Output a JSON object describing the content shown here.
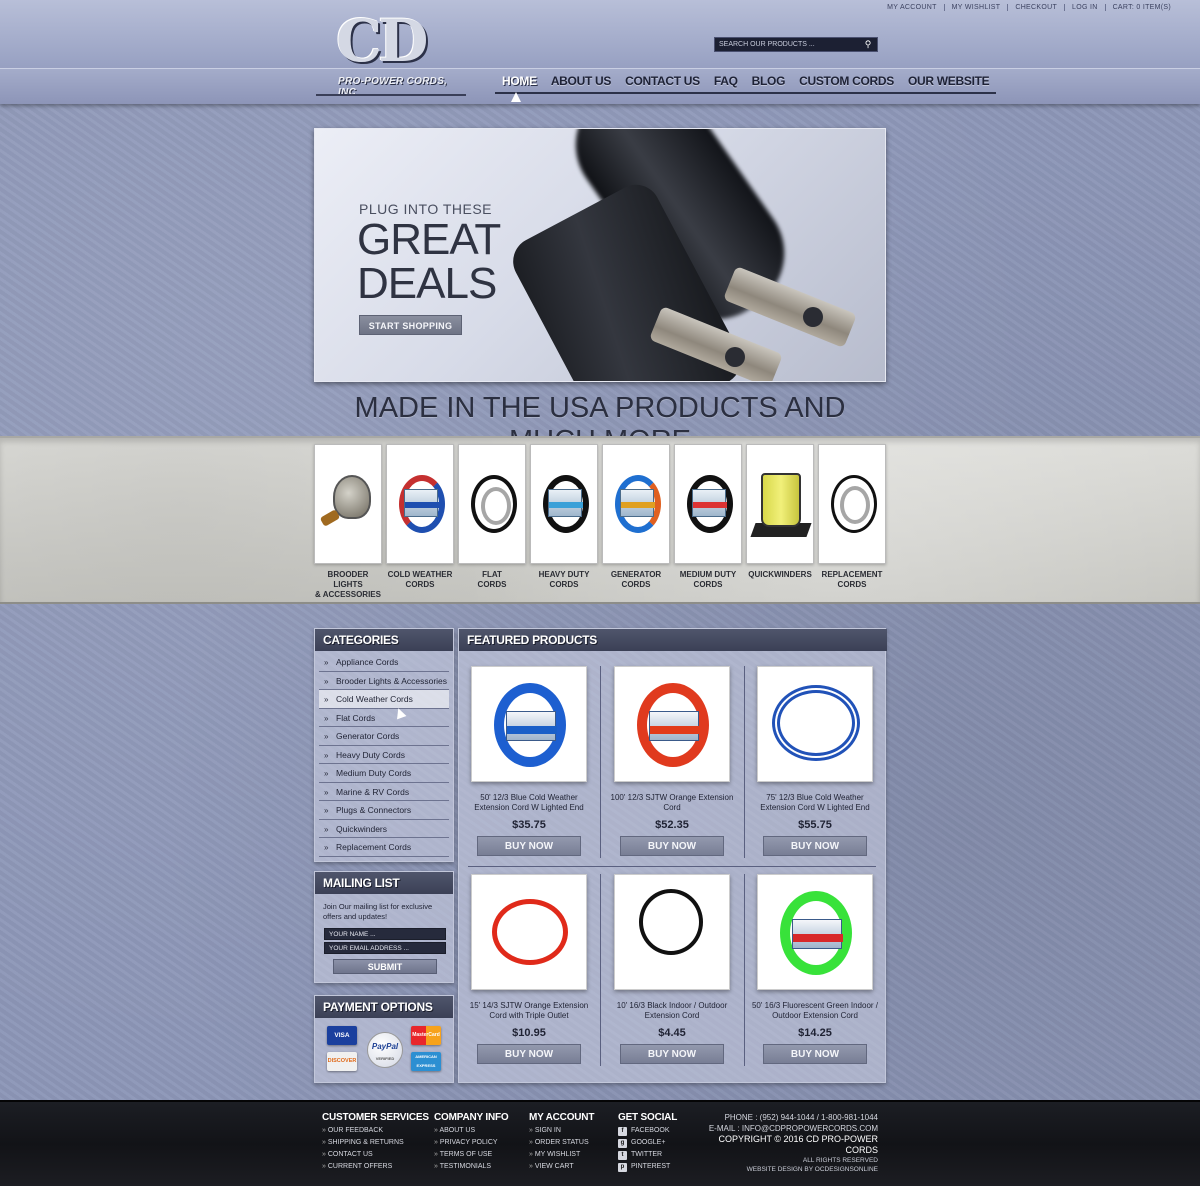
{
  "top_links": [
    "MY ACCOUNT",
    "MY WISHLIST",
    "CHECKOUT",
    "LOG IN",
    "CART: 0 ITEM(S)"
  ],
  "search": {
    "placeholder": "SEARCH OUR PRODUCTS ..."
  },
  "logo": {
    "letters": "CD",
    "tagline": "PRO-POWER CORDS, INC"
  },
  "nav": [
    {
      "label": "HOME",
      "active": true
    },
    {
      "label": "ABOUT US"
    },
    {
      "label": "CONTACT US"
    },
    {
      "label": "FAQ"
    },
    {
      "label": "BLOG"
    },
    {
      "label": "CUSTOM CORDS"
    },
    {
      "label": "OUR WEBSITE"
    }
  ],
  "hero": {
    "line1": "PLUG INTO THESE",
    "line2": "GREAT",
    "line3": "DEALS",
    "button": "START SHOPPING"
  },
  "tagline": "MADE IN THE USA PRODUCTS AND MUCH MORE",
  "category_tiles": [
    {
      "line1": "BROODER LIGHTS",
      "line2": "& ACCESSORIES"
    },
    {
      "line1": "COLD WEATHER",
      "line2": "CORDS"
    },
    {
      "line1": "FLAT",
      "line2": "CORDS"
    },
    {
      "line1": "HEAVY DUTY",
      "line2": "CORDS"
    },
    {
      "line1": "GENERATOR",
      "line2": "CORDS"
    },
    {
      "line1": "MEDIUM DUTY",
      "line2": "CORDS"
    },
    {
      "line1": "QUICKWINDERS",
      "line2": ""
    },
    {
      "line1": "REPLACEMENT",
      "line2": "CORDS"
    }
  ],
  "categories": {
    "title": "CATEGORIES",
    "items": [
      "Appliance Cords",
      "Brooder Lights & Accessories",
      "Cold Weather Cords",
      "Flat Cords",
      "Generator Cords",
      "Heavy Duty Cords",
      "Medium Duty Cords",
      "Marine & RV Cords",
      "Plugs & Connectors",
      "Quickwinders",
      "Replacement Cords"
    ]
  },
  "mailing": {
    "title": "MAILING LIST",
    "text": "Join Our mailing list for exclusive offers and updates!",
    "name_placeholder": "YOUR NAME ...",
    "email_placeholder": "YOUR EMAIL ADDRESS ...",
    "submit": "SUBMIT"
  },
  "payment": {
    "title": "PAYMENT OPTIONS",
    "cards": [
      "VISA",
      "DISCOVER",
      "MasterCard",
      "AMERICAN EXPRESS"
    ],
    "paypal": "PayPal",
    "paypal_sub": "VERIFIED"
  },
  "featured": {
    "title": "FEATURED PRODUCTS",
    "products": [
      {
        "title": "50' 12/3 Blue Cold Weather Extension Cord W Lighted End",
        "price": "$35.75",
        "button": "BUY NOW"
      },
      {
        "title": "100' 12/3 SJTW Orange Extension Cord",
        "price": "$52.35",
        "button": "BUY NOW"
      },
      {
        "title": "75' 12/3 Blue Cold Weather Extension Cord W Lighted End",
        "price": "$55.75",
        "button": "BUY NOW"
      },
      {
        "title": "15' 14/3 SJTW Orange Extension Cord with Triple Outlet",
        "price": "$10.95",
        "button": "BUY NOW"
      },
      {
        "title": "10' 16/3 Black Indoor / Outdoor Extension Cord",
        "price": "$4.45",
        "button": "BUY NOW"
      },
      {
        "title": "50' 16/3 Fluorescent Green Indoor / Outdoor Extension Cord",
        "price": "$14.25",
        "button": "BUY NOW"
      }
    ]
  },
  "footer": {
    "customer_services": {
      "title": "CUSTOMER SERVICES",
      "links": [
        "OUR FEEDBACK",
        "SHIPPING & RETURNS",
        "CONTACT US",
        "CURRENT OFFERS"
      ]
    },
    "company_info": {
      "title": "COMPANY INFO",
      "links": [
        "ABOUT US",
        "PRIVACY POLICY",
        "TERMS OF USE",
        "TESTIMONIALS"
      ]
    },
    "my_account": {
      "title": "MY ACCOUNT",
      "links": [
        "SIGN IN",
        "ORDER STATUS",
        "MY WISHLIST",
        "VIEW CART"
      ]
    },
    "get_social": {
      "title": "GET SOCIAL",
      "links": [
        "FACEBOOK",
        "GOOGLE+",
        "TWITTER",
        "PINTEREST"
      ]
    },
    "phone": "PHONE : (952) 944-1044  /  1-800-981-1044",
    "email": "E-MAIL : INFO@CDPROPOWERCORDS.COM",
    "copyright": "COPYRIGHT © 2016 CD PRO-POWER CORDS",
    "rights": "ALL RIGHTS RESERVED",
    "design": "WEBSITE DESIGN BY OCDESIGNSONLINE"
  },
  "colors": {
    "page_bg": "#8d97b8",
    "panel_header": "#3b4056",
    "footer_bg": "#121317",
    "button": "#787e95"
  }
}
